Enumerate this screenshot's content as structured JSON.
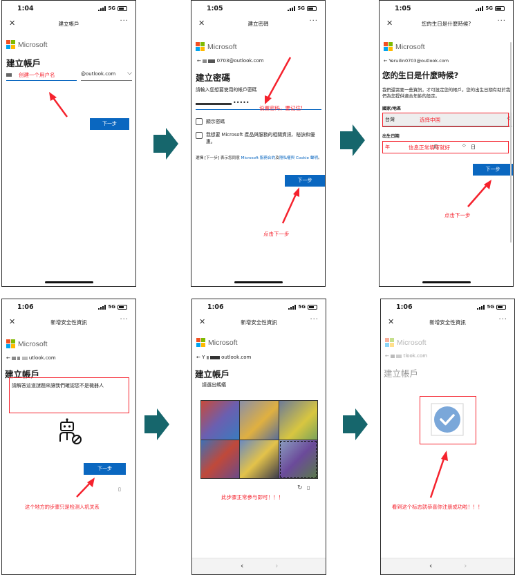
{
  "panel1": {
    "time": "1:04",
    "network": "5G",
    "nav_title": "建立帳戶",
    "brand": "Microsoft",
    "heading": "建立帳戶",
    "username_annotation": "创建一个用户名",
    "domain_value": "@outlook.com",
    "next_label": "下一步"
  },
  "panel2": {
    "time": "1:05",
    "network": "5G",
    "nav_title": "建立密碼",
    "brand": "Microsoft",
    "email_suffix": "0703@outlook.com",
    "heading": "建立密碼",
    "instruction": "請輸入您想要使用的帳戶密碼",
    "password_mask": "•••••",
    "password_annotation": "设置密码，要记住!",
    "show_password": "顯示密碼",
    "promo_optin": "我想要 Microsoft 產品與服務的相關資訊、秘訣和優惠。",
    "terms_prefix": "選擇 [下一步] 表示您同意",
    "terms_link1": "Microsoft 服務合約",
    "terms_and": "及",
    "terms_link2": "隱私權與 Cookie 聲明",
    "terms_end": "。",
    "next_label": "下一步",
    "click_annotation": "点击下一步"
  },
  "panel3": {
    "time": "1:05",
    "network": "5G",
    "nav_title": "您的生日是什麼時候?",
    "brand": "Microsoft",
    "email": "Yeruilin0703@outlook.com",
    "heading": "您的生日是什麼時候?",
    "description": "我們還需要一些資訊，才可設定您的帳戶。您的出生日期有助於我們為您提供適合年齡的設定。",
    "country_label": "國家/地區",
    "country_value": "台灣",
    "country_annotation": "选择中国",
    "birth_label": "出生日期",
    "year_unit": "年",
    "birth_annotation": "信息正常填写就好",
    "month_unit": "月",
    "day_unit": "日",
    "next_label": "下一步",
    "click_annotation": "点击下一步"
  },
  "panel4": {
    "time": "1:06",
    "network": "5G",
    "nav_title": "新增安全性資訊",
    "brand": "Microsoft",
    "email_suffix": "utlook.com",
    "heading": "建立帳戶",
    "captcha_prompt": "請解答這道謎題來讓我們確認您不是機器人",
    "next_label": "下一步",
    "note_annotation": "这个地方的步骤只是检测人机关系"
  },
  "panel5": {
    "time": "1:06",
    "network": "5G",
    "nav_title": "新增安全性資訊",
    "brand": "Microsoft",
    "email_prefix": "Y",
    "email_suffix": "outlook.com",
    "heading": "建立帳戶",
    "captcha_instruction": "請選出螞蟻",
    "annotation": "此步骤正常参与即可！！！"
  },
  "panel6": {
    "time": "1:06",
    "network": "5G",
    "nav_title": "新增安全性資訊",
    "brand": "Microsoft",
    "email_suffix": "tlook.com",
    "heading": "建立帳戶",
    "success_annotation": "看到这个标志就恭喜你注册成功啦！！！"
  },
  "colors": {
    "ms_red": "#f25022",
    "ms_green": "#7fba00",
    "ms_blue": "#00a4ef",
    "ms_yellow": "#ffb900",
    "button_blue": "#0a67c0",
    "annotation_red": "#f5222d",
    "flow_arrow": "#16666c",
    "check_blue": "#7aa7d9"
  },
  "icons": [
    "close-icon",
    "more-icon",
    "chevron-down-icon",
    "back-arrow-icon",
    "robot-icon",
    "refresh-icon",
    "audio-icon",
    "checkmark-icon",
    "flow-arrow-icon"
  ]
}
